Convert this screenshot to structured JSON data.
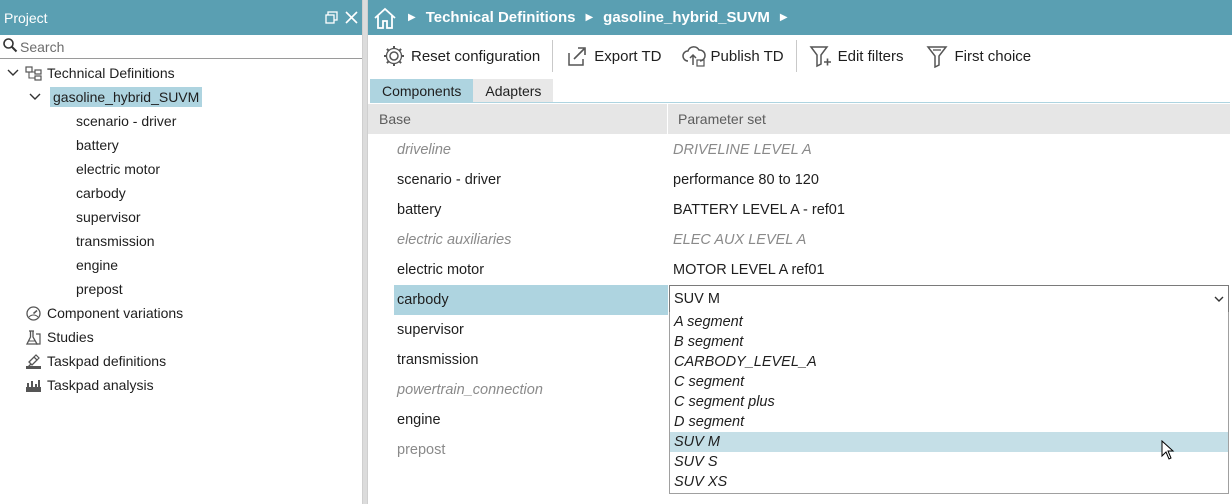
{
  "left_panel": {
    "title": "Project",
    "search_placeholder": "Search",
    "tree": [
      {
        "label": "Technical Definitions",
        "icon": "technical-definitions-icon"
      },
      {
        "label": "gasoline_hybrid_SUVM",
        "selected": true
      },
      {
        "label": "scenario - driver"
      },
      {
        "label": "battery"
      },
      {
        "label": "electric motor"
      },
      {
        "label": "carbody"
      },
      {
        "label": "supervisor"
      },
      {
        "label": "transmission"
      },
      {
        "label": "engine"
      },
      {
        "label": "prepost"
      },
      {
        "label": "Component variations",
        "icon": "component-variations-icon"
      },
      {
        "label": "Studies",
        "icon": "studies-icon"
      },
      {
        "label": "Taskpad definitions",
        "icon": "taskpad-definitions-icon"
      },
      {
        "label": "Taskpad analysis",
        "icon": "taskpad-analysis-icon"
      }
    ]
  },
  "breadcrumb": [
    "Technical Definitions",
    "gasoline_hybrid_SUVM"
  ],
  "toolbar": {
    "reset": "Reset configuration",
    "export": "Export TD",
    "publish": "Publish TD",
    "edit_filters": "Edit filters",
    "first_choice": "First choice"
  },
  "tabs": [
    "Components",
    "Adapters"
  ],
  "grid": {
    "headers": [
      "Base",
      "Parameter set"
    ],
    "rows": [
      {
        "base": "driveline",
        "param": "DRIVELINE LEVEL A",
        "disabled": true
      },
      {
        "base": "scenario - driver",
        "param": "performance 80 to 120"
      },
      {
        "base": "battery",
        "param": "BATTERY LEVEL A - ref01"
      },
      {
        "base": "electric auxiliaries",
        "param": "ELEC AUX LEVEL A",
        "disabled": true
      },
      {
        "base": "electric motor",
        "param": "MOTOR LEVEL A ref01"
      },
      {
        "base": "carbody",
        "param": "SUV M",
        "selected": true
      },
      {
        "base": "supervisor",
        "param": ""
      },
      {
        "base": "transmission",
        "param": ""
      },
      {
        "base": "powertrain_connection",
        "param": "",
        "disabled": true
      },
      {
        "base": "engine",
        "param": ""
      },
      {
        "base": "prepost",
        "param": "",
        "disabled": true
      }
    ]
  },
  "combo": {
    "value": "SUV M",
    "options": [
      "A segment",
      "B segment",
      "CARBODY_LEVEL_A",
      "C segment",
      "C segment plus",
      "D segment",
      "SUV M",
      "SUV S",
      "SUV XS"
    ],
    "highlighted": "SUV M"
  },
  "colors": {
    "header_bg": "#5a9fb2",
    "selection": "#aed4e0",
    "hover": "#c5dfe7"
  }
}
